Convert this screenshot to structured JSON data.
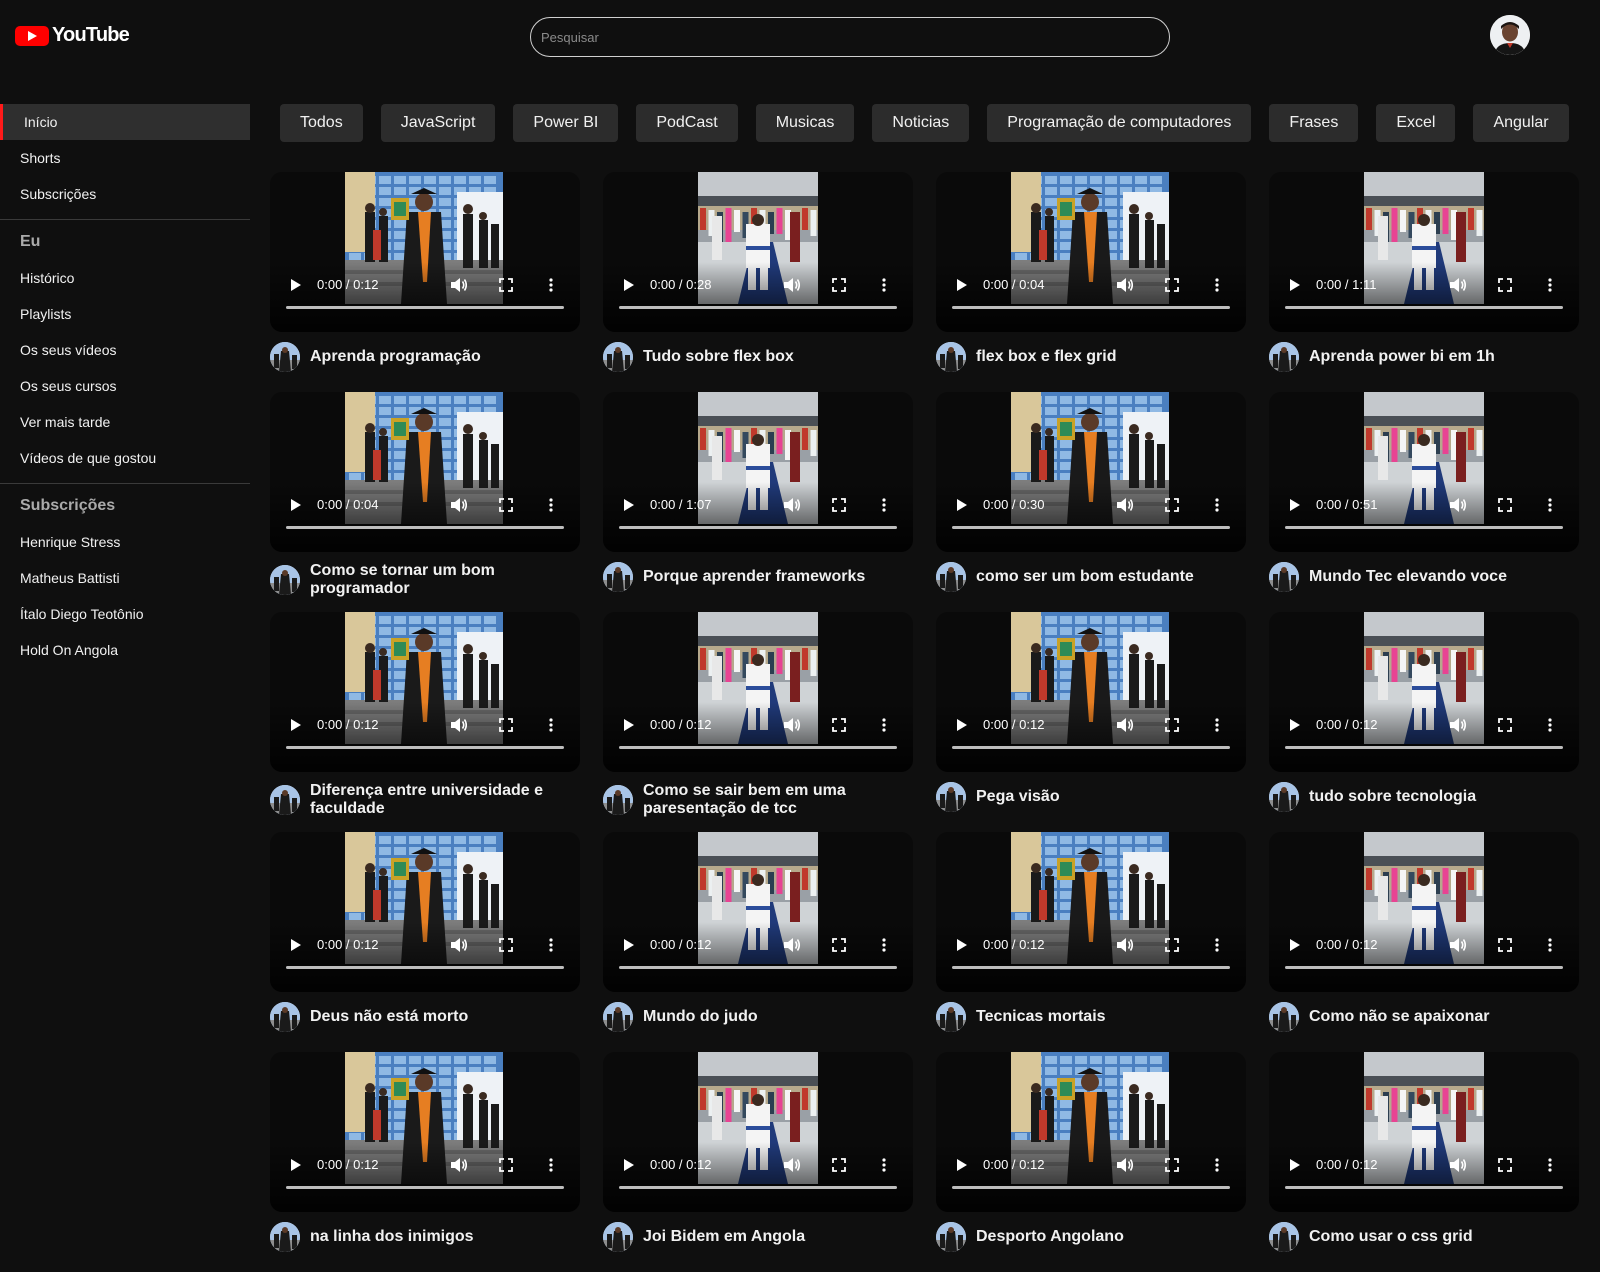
{
  "header": {
    "logo_text": "YouTube",
    "search_placeholder": "Pesquisar"
  },
  "sidebar": {
    "primary": [
      "Início",
      "Shorts",
      "Subscrições"
    ],
    "me_title": "Eu",
    "me_items": [
      "Histórico",
      "Playlists",
      "Os seus vídeos",
      "Os seus cursos",
      "Ver mais tarde",
      "Vídeos de que gostou"
    ],
    "subs_title": "Subscrições",
    "subs_items": [
      "Henrique Stress",
      "Matheus Battisti",
      "Ítalo Diego Teotônio",
      "Hold On Angola"
    ]
  },
  "chips": [
    "Todos",
    "JavaScript",
    "Power BI",
    "PodCast",
    "Musicas",
    "Noticias",
    "Programação de computadores",
    "Frases",
    "Excel",
    "Angular"
  ],
  "videos": [
    {
      "title": "Aprenda programação",
      "time": "0:00 / 0:12",
      "thumb": "grad"
    },
    {
      "title": "Tudo sobre flex box",
      "time": "0:00 / 0:28",
      "thumb": "judo"
    },
    {
      "title": "flex box e flex grid",
      "time": "0:00 / 0:04",
      "thumb": "grad"
    },
    {
      "title": "Aprenda power bi em 1h",
      "time": "0:00 / 1:11",
      "thumb": "judo"
    },
    {
      "title": "Como se tornar um bom programador",
      "time": "0:00 / 0:04",
      "thumb": "grad"
    },
    {
      "title": "Porque aprender frameworks",
      "time": "0:00 / 1:07",
      "thumb": "judo"
    },
    {
      "title": "como ser um bom estudante",
      "time": "0:00 / 0:30",
      "thumb": "grad"
    },
    {
      "title": "Mundo Tec elevando voce",
      "time": "0:00 / 0:51",
      "thumb": "judo"
    },
    {
      "title": "Diferença entre universidade e faculdade",
      "time": "0:00 / 0:12",
      "thumb": "grad"
    },
    {
      "title": "Como se sair bem em uma paresentação de tcc",
      "time": "0:00 / 0:12",
      "thumb": "judo"
    },
    {
      "title": "Pega visão",
      "time": "0:00 / 0:12",
      "thumb": "grad"
    },
    {
      "title": "tudo sobre tecnologia",
      "time": "0:00 / 0:12",
      "thumb": "judo"
    },
    {
      "title": "Deus não está morto",
      "time": "0:00 / 0:12",
      "thumb": "grad"
    },
    {
      "title": "Mundo do judo",
      "time": "0:00 / 0:12",
      "thumb": "judo"
    },
    {
      "title": "Tecnicas mortais",
      "time": "0:00 / 0:12",
      "thumb": "grad"
    },
    {
      "title": "Como não se apaixonar",
      "time": "0:00 / 0:12",
      "thumb": "judo"
    },
    {
      "title": "na linha dos inimigos",
      "time": "0:00 / 0:12",
      "thumb": "grad"
    },
    {
      "title": "Joi Bidem em Angola",
      "time": "0:00 / 0:12",
      "thumb": "judo"
    },
    {
      "title": "Desporto Angolano",
      "time": "0:00 / 0:12",
      "thumb": "grad"
    },
    {
      "title": "Como usar o css grid",
      "time": "0:00 / 0:12",
      "thumb": "judo"
    }
  ],
  "colors": {
    "background": "#0f0f0f",
    "accent": "#ff0000",
    "chip": "#2c2c2c",
    "active_nav": "#2f2f2f"
  }
}
